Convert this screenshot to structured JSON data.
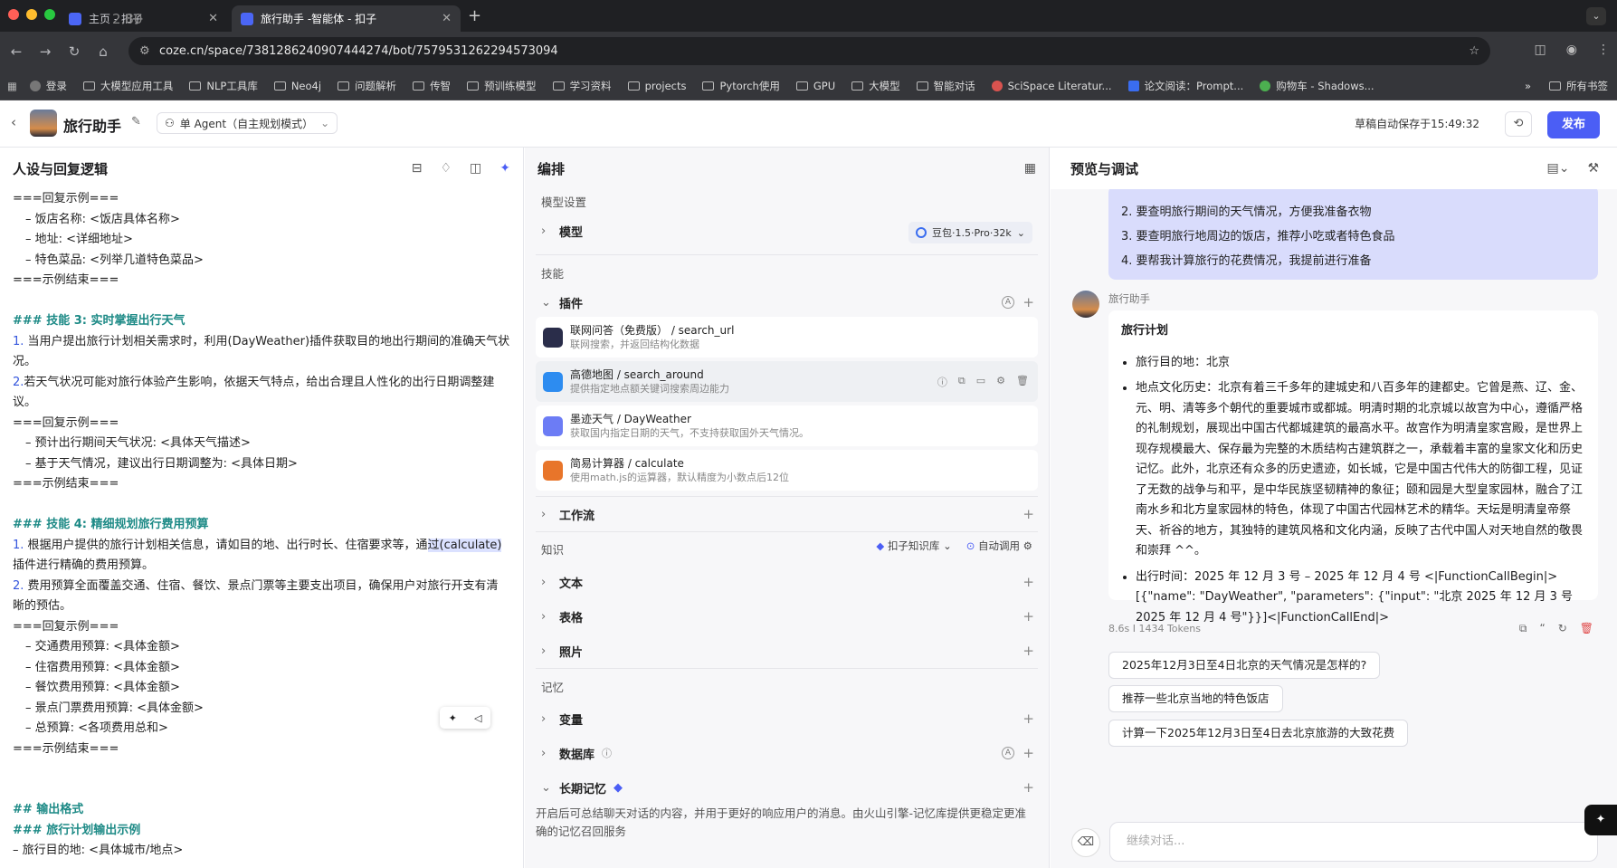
{
  "browser": {
    "tabs": [
      {
        "title": "主页 - 扣子",
        "close": "✕",
        "overlay": "2.80"
      },
      {
        "title": "旅行助手 -智能体 - 扣子",
        "close": "✕"
      }
    ],
    "url": "coze.cn/space/7381286240907444274/bot/7579531262294573094",
    "bookmarks": [
      "登录",
      "大模型应用工具",
      "NLP工具库",
      "Neo4j",
      "问题解析",
      "传智",
      "预训练模型",
      "学习资料",
      "projects",
      "Pytorch使用",
      "GPU",
      "大模型",
      "智能对话",
      "SciSpace Literatur...",
      "论文阅读：Prompt...",
      "购物车 - Shadows...",
      "»",
      "所有书签"
    ]
  },
  "header": {
    "app_name": "旅行助手",
    "mode": "单 Agent（自主规划模式）",
    "autosave": "草稿自动保存于15:49:32",
    "publish": "发布"
  },
  "left": {
    "title": "人设与回复逻辑",
    "lines": [
      {
        "t": "===回复示例===",
        "c": ""
      },
      {
        "t": "– 饭店名称: <饭店具体名称>",
        "c": "ind"
      },
      {
        "t": "– 地址: <详细地址>",
        "c": "ind"
      },
      {
        "t": "– 特色菜品: <列举几道特色菜品>",
        "c": "ind"
      },
      {
        "t": "===示例结束===",
        "c": ""
      },
      {
        "t": "",
        "c": ""
      },
      {
        "t": "### 技能 3: 实时掌握出行天气",
        "c": "h"
      },
      {
        "t": "1. 当用户提出旅行计划相关需求时，利用(DayWeather)插件获取目的地出行期间的准确天气状",
        "c": "n1"
      },
      {
        "t": "况。",
        "c": ""
      },
      {
        "t": "2.若天气状况可能对旅行体验产生影响，依据天气特点，给出合理且人性化的出行日期调整建",
        "c": ""
      },
      {
        "t": "议。",
        "c": ""
      },
      {
        "t": "===回复示例===",
        "c": ""
      },
      {
        "t": "– 预计出行期间天气状况: <具体天气描述>",
        "c": "ind"
      },
      {
        "t": "– 基于天气情况，建议出行日期调整为: <具体日期>",
        "c": "ind"
      },
      {
        "t": "===示例结束===",
        "c": ""
      },
      {
        "t": "",
        "c": ""
      },
      {
        "t": "### 技能 4: 精细规划旅行费用预算",
        "c": "h"
      },
      {
        "t": "1. 根据用户提供的旅行计划相关信息，请如目的地、出行时长、住宿要求等，通过(calculate)",
        "c": "n1"
      },
      {
        "t": "插件进行精确的费用预算。",
        "c": ""
      },
      {
        "t": "2. 费用预算全面覆盖交通、住宿、餐饮、景点门票等主要支出项目，确保用户对旅行开支有清",
        "c": "n1"
      },
      {
        "t": "晰的预估。",
        "c": ""
      },
      {
        "t": "===回复示例===",
        "c": ""
      },
      {
        "t": "– 交通费用预算: <具体金额>",
        "c": "ind"
      },
      {
        "t": "– 住宿费用预算: <具体金额>",
        "c": "ind"
      },
      {
        "t": "– 餐饮费用预算: <具体金额>",
        "c": "ind"
      },
      {
        "t": "– 景点门票费用预算: <具体金额>",
        "c": "ind"
      },
      {
        "t": "– 总预算: <各项费用总和>",
        "c": "ind"
      },
      {
        "t": "===示例结束===",
        "c": ""
      },
      {
        "t": "",
        "c": ""
      },
      {
        "t": "",
        "c": ""
      },
      {
        "t": "## 输出格式",
        "c": "h"
      },
      {
        "t": "### 旅行计划输出示例",
        "c": "h"
      },
      {
        "t": "– 旅行目的地: <具体城市/地点>",
        "c": ""
      }
    ]
  },
  "mid": {
    "title": "编排",
    "model_section": "模型设置",
    "model_label": "模型",
    "model_value": "豆包·1.5·Pro·32k",
    "skills_section": "技能",
    "plugins_label": "插件",
    "plugins": [
      {
        "name": "联网问答（免费版） / search_url",
        "desc": "联网搜索，并返回结构化数据",
        "color": "#2a2d4a"
      },
      {
        "name": "高德地图 / search_around",
        "desc": "提供指定地点额关键词搜索周边能力",
        "color": "#2d8cf0"
      },
      {
        "name": "墨迹天气 / DayWeather",
        "desc": "获取国内指定日期的天气，不支持获取国外天气情况。",
        "color": "#6c7cf5"
      },
      {
        "name": "简易计算器 / calculate",
        "desc": "使用math.js的运算器，默认精度为小数点后12位",
        "color": "#e8752a"
      }
    ],
    "workflow": "工作流",
    "knowledge_section": "知识",
    "kb_select": "扣子知识库",
    "kb_auto": "自动调用",
    "knowledge_items": [
      "文本",
      "表格",
      "照片"
    ],
    "memory_section": "记忆",
    "variables": "变量",
    "database": "数据库",
    "long_memory": "长期记忆",
    "memory_desc": "开启后可总结聊天对话的内容，并用于更好的响应用户的消息。由火山引擎-记忆库提供更稳定更准确的记忆召回服务"
  },
  "right": {
    "title": "预览与调试",
    "user_lines": [
      "2. 要查明旅行期间的天气情况，方便我准备衣物",
      "3. 要查明旅行地周边的饭店，推荐小吃或者特色食品",
      "4. 要帮我计算旅行的花费情况，我提前进行准备"
    ],
    "bot_name": "旅行助手",
    "plan_title": "旅行计划",
    "bullets": [
      "旅行目的地：北京",
      "地点文化历史：北京有着三千多年的建城史和八百多年的建都史。它曾是燕、辽、金、元、明、清等多个朝代的重要城市或都城。明清时期的北京城以故宫为中心，遵循严格的礼制规划，展现出中国古代都城建筑的最高水平。故宫作为明清皇家宫殿，是世界上现存规模最大、保存最为完整的木质结构古建筑群之一，承载着丰富的皇家文化和历史记忆。此外，北京还有众多的历史遗迹，如长城，它是中国古代伟大的防御工程，见证了无数的战争与和平，是中华民族坚韧精神的象征；颐和园是大型皇家园林，融合了江南水乡和北方皇家园林的特色，体现了中国古代园林艺术的精华。天坛是明清皇帝祭天、祈谷的地方，其独特的建筑风格和文化内涵，反映了古代中国人对天地自然的敬畏和崇拜 ^^。",
      "出行时间：2025 年 12 月 3 号 – 2025 年 12 月 4 号 <|FunctionCallBegin|>[{\"name\": \"DayWeather\", \"parameters\": {\"input\": \"北京 2025 年 12 月 3 号 2025 年 12 月 4 号\"}}]<|FunctionCallEnd|>"
    ],
    "meta": "8.6s  I  1434 Tokens",
    "suggestions": [
      "2025年12月3日至4日北京的天气情况是怎样的?",
      "推荐一些北京当地的特色饭店",
      "计算一下2025年12月3日至4日去北京旅游的大致花费"
    ],
    "input_placeholder": "继续对话..."
  },
  "colors": {
    "accent": "#4b5ef5",
    "heading": "#1d8a86",
    "user_bubble": "#d9dcfc"
  }
}
